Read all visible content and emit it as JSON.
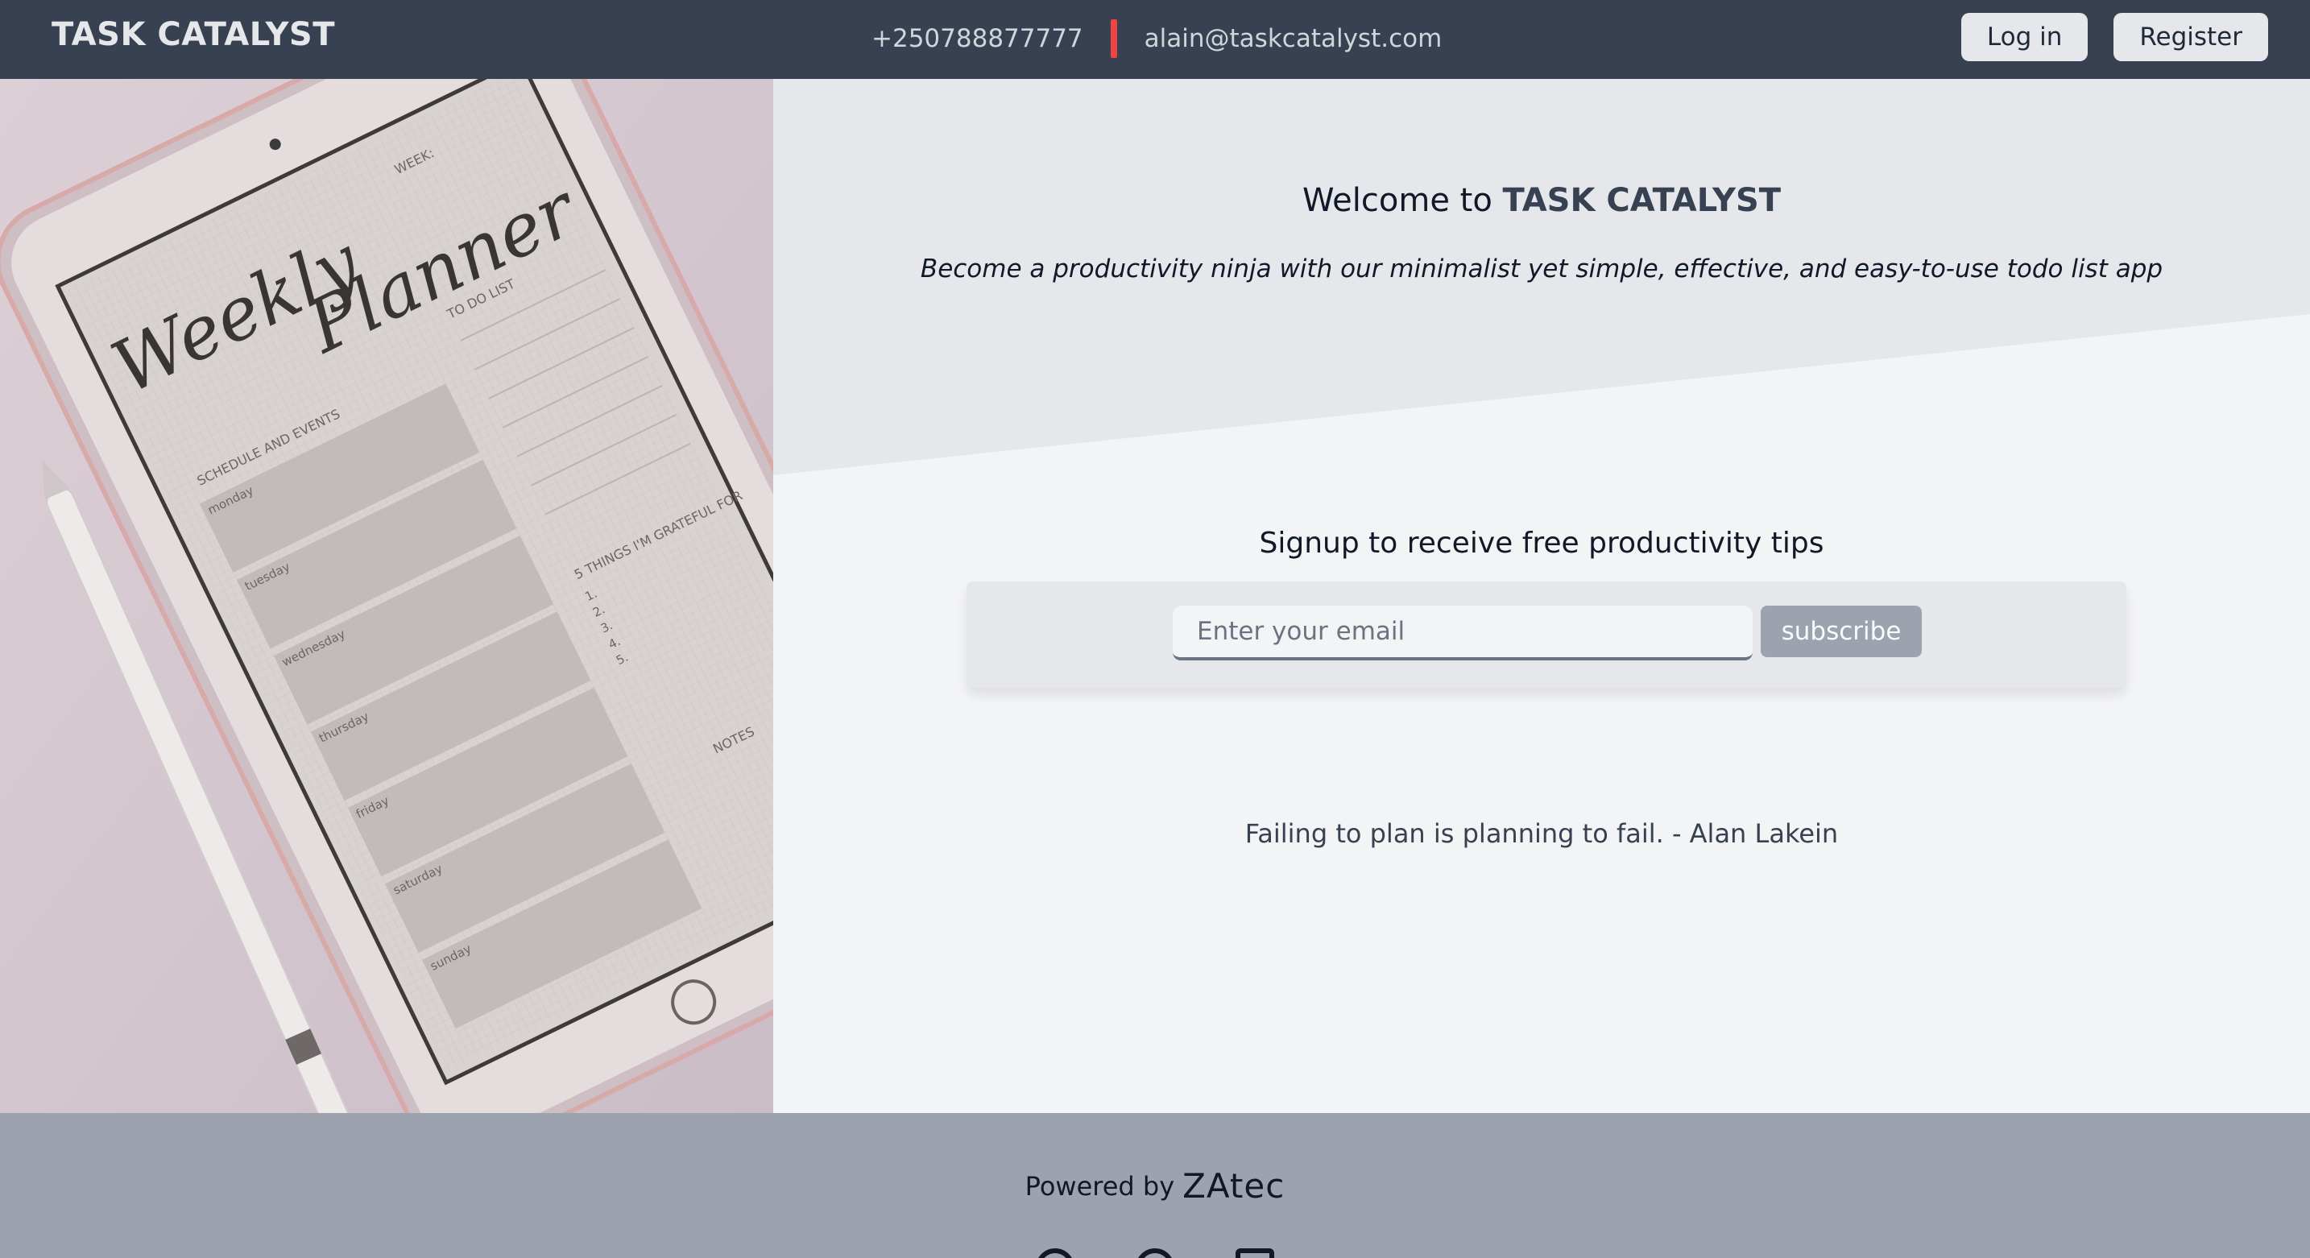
{
  "header": {
    "brand": "TASK CATALYST",
    "phone": "+250788877777",
    "email": "alain@taskcatalyst.com",
    "login_label": "Log in",
    "register_label": "Register"
  },
  "hero_image": {
    "planner_title_1": "Weekly",
    "planner_title_2": "Planner",
    "week_label": "WEEK:",
    "todo_label": "TO DO LIST",
    "schedule_label": "SCHEDULE AND EVENTS",
    "grateful_label": "5 THINGS I'M GRATEFUL FOR",
    "notes_label": "NOTES",
    "days": [
      "monday",
      "tuesday",
      "wednesday",
      "thursday",
      "friday",
      "saturday",
      "sunday"
    ],
    "numbers": [
      "1.",
      "2.",
      "3.",
      "4.",
      "5."
    ]
  },
  "main": {
    "welcome_prefix": "Welcome to ",
    "welcome_brand": "TASK CATALYST",
    "tagline": "Become a productivity ninja with our minimalist yet simple, effective, and easy-to-use todo list app",
    "signup_title": "Signup to receive free productivity tips",
    "email_placeholder": "Enter your email",
    "subscribe_label": "subscribe",
    "quote": "Failing to plan is planning to fail. - Alan Lakein"
  },
  "footer": {
    "powered_by": "Powered by",
    "company_logo": "ZAtec"
  },
  "colors": {
    "header_bg": "#374151",
    "accent_separator": "#ef4444",
    "page_bg": "#f3f4f6",
    "footer_bg": "#9ca3af"
  }
}
